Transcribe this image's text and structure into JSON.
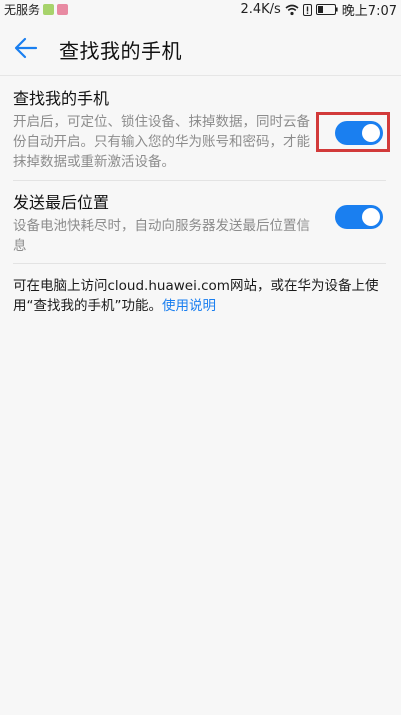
{
  "status_bar": {
    "carrier": "无服务",
    "speed": "2.4K/s",
    "time": "晚上7:07"
  },
  "app_bar": {
    "title": "查找我的手机"
  },
  "settings": [
    {
      "title": "查找我的手机",
      "description": "开启后，可定位、锁住设备、抹掉数据，同时云备份自动开启。只有输入您的华为账号和密码，才能抹掉数据或重新激活设备。",
      "enabled": true
    },
    {
      "title": "发送最后位置",
      "description": "设备电池快耗尽时，自动向服务器发送最后位置信息",
      "enabled": true
    }
  ],
  "info": {
    "text": "可在电脑上访问cloud.huawei.com网站，或在华为设备上使用“查找我的手机”功能。",
    "link": "使用说明"
  },
  "colors": {
    "accent": "#1a7ff0",
    "highlight": "#d23a3a"
  }
}
